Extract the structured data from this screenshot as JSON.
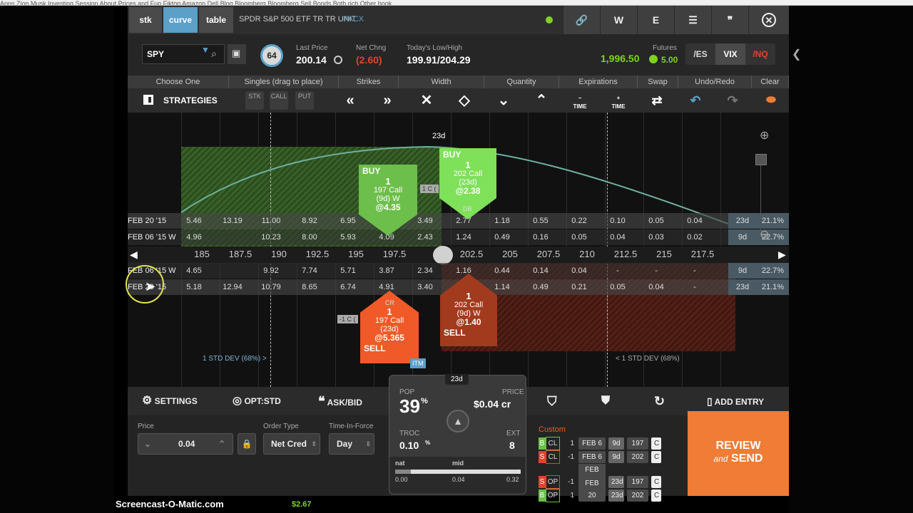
{
  "browser": {
    "bookmarks": "Apps   Zion Musk   Investing   Session   About Prices and Fun   Fiktop   Amazon   Dell   Blog   Bloomberg   Bloomberg   Sell   Bonds   Both rich   Other book"
  },
  "tabs": [
    {
      "label": "stk",
      "active": false
    },
    {
      "label": "curve",
      "active": true
    },
    {
      "label": "table",
      "active": false
    }
  ],
  "window": {
    "symbol_desc": "SPDR S&P 500 ETF TR TR UNIT",
    "exchange": "PACX",
    "buttons": [
      "W",
      "E"
    ]
  },
  "quote": {
    "symbol": "SPY",
    "iv_rank": "64",
    "last_label": "Last Price",
    "last": "200.14",
    "chg_label": "Net Chng",
    "chg": "(2.60)",
    "range_label": "Today's Low/High",
    "range": "199.91/204.29",
    "fut_label": "Futures",
    "fut": "1,996.50",
    "fut_chg": "5.00",
    "fut_buttons": [
      "/ES",
      "VIX",
      "/NQ"
    ]
  },
  "headers": [
    "Choose One",
    "Singles (drag to place)",
    "Strikes",
    "Width",
    "Quantity",
    "Expirations",
    "Swap",
    "Undo/Redo",
    "Clear"
  ],
  "tools": {
    "strategies": "STRATEGIES",
    "singles": [
      "STK",
      "CALL",
      "PUT"
    ],
    "minus_time": "TIME",
    "plus_time": "TIME"
  },
  "curve": {
    "top_label": "23d",
    "strikes": [
      "185",
      "187.5",
      "190",
      "192.5",
      "195",
      "197.5",
      "",
      "202.5",
      "205",
      "207.5",
      "210",
      "212.5",
      "215",
      "217.5"
    ],
    "rows": [
      {
        "label": "FEB 20 '15",
        "vals": [
          "5.46",
          "13.19",
          "11.00",
          "8.92",
          "6.95",
          "5.13",
          "3.49",
          "2.77",
          "1.18",
          "0.55",
          "0.22",
          "0.10",
          "0.05",
          "0.04"
        ],
        "days": "23d",
        "iv": "21.1%"
      },
      {
        "label": "FEB 06 '15 W",
        "vals": [
          "4.96",
          "",
          "10.23",
          "8.00",
          "5.93",
          "4.09",
          "2.43",
          "1.24",
          "0.49",
          "0.16",
          "0.05",
          "0.04",
          "0.03",
          "0.02"
        ],
        "days": "9d",
        "iv": "22.7%"
      },
      {
        "label": "FEB 06 '15 W",
        "vals": [
          "4.65",
          "",
          "9.92",
          "7.74",
          "5.71",
          "3.87",
          "2.34",
          "1.16",
          "0.44",
          "0.14",
          "0.04",
          "-",
          "-",
          "-"
        ],
        "days": "9d",
        "iv": "22.7%"
      },
      {
        "label": "FEB 20 '15",
        "vals": [
          "5.18",
          "12.94",
          "10.79",
          "8.65",
          "6.74",
          "4.91",
          "3.40",
          "2.09",
          "1.14",
          "0.49",
          "0.21",
          "0.05",
          "0.04",
          "-"
        ],
        "days": "23d",
        "iv": "21.1%"
      }
    ],
    "std_left": "1 STD DEV (68%) >",
    "std_right": "< 1 STD DEV (68%)",
    "tickets": [
      {
        "side": "BUY",
        "qty": "1",
        "desc": "197 Call",
        "exp": "(9d) W",
        "price": "@4.35",
        "type": "CALL"
      },
      {
        "side": "BUY",
        "qty": "1",
        "desc": "202 Call",
        "exp": "(23d)",
        "price": "@2.38",
        "type": "CALL"
      },
      {
        "side": "SELL",
        "qty": "1",
        "desc": "197 Call",
        "exp": "(23d)",
        "price": "@5.365",
        "type": "CALL"
      },
      {
        "side": "SELL",
        "qty": "1",
        "desc": "202 Call",
        "exp": "(9d) W",
        "price": "@1.40",
        "type": "CALL"
      }
    ],
    "small_labels": {
      "c1": "1 C (",
      "c2": "-1 C (",
      "itm": "ITM",
      "db": "DB",
      "cr": "CR"
    }
  },
  "bottom": {
    "settings": "SETTINGS",
    "opt": "OPT:STD",
    "askbid": "ASK/BID",
    "add": "ADD ENTRY"
  },
  "order": {
    "price_label": "Price",
    "price": "0.04",
    "ordertype_label": "Order Type",
    "ordertype": "Net Cred",
    "tif_label": "Time-In-Force",
    "tif": "Day"
  },
  "pop": {
    "days": "23d",
    "pop_label": "POP",
    "pop": "39",
    "pop_unit": "%",
    "price_label": "PRICE",
    "price": "$0.04 cr",
    "troc_label": "TROC",
    "troc": "0.10",
    "troc_unit": "%",
    "ext_label": "EXT",
    "ext": "8",
    "nat_label": "nat",
    "mid_label": "mid",
    "nat": "0.00",
    "mid": "0.04",
    "hi": "0.32",
    "mid_fraction": 0.125
  },
  "legs": {
    "title": "Custom",
    "rows": [
      {
        "side": "B",
        "type": "CL",
        "qty": "1",
        "exp": "FEB 6",
        "days": "9d",
        "strike": "197",
        "cp": "C"
      },
      {
        "side": "S",
        "type": "CL",
        "qty": "-1",
        "exp": "FEB 6",
        "days": "9d",
        "strike": "202",
        "cp": "C"
      },
      {
        "side": "S",
        "type": "OP",
        "qty": "-1",
        "exp": "FEB 20",
        "days": "23d",
        "strike": "197",
        "cp": "C"
      },
      {
        "side": "B",
        "type": "OP",
        "qty": "1",
        "exp": "FEB 20",
        "days": "23d",
        "strike": "202",
        "cp": "C"
      }
    ]
  },
  "review": {
    "line1": "REVIEW",
    "and": "and",
    "line2": "SEND"
  },
  "watermark": "Screencast-O-Matic.com",
  "side_values": {
    "a": "$2.67"
  },
  "colors": {
    "accent_blue": "#5aa0c8",
    "buy_green": "#6dbf4b",
    "sell_orange": "#f05a28",
    "review": "#f07c35",
    "profit_green": "#3f6b2b",
    "loss_red": "#5a1e16"
  }
}
